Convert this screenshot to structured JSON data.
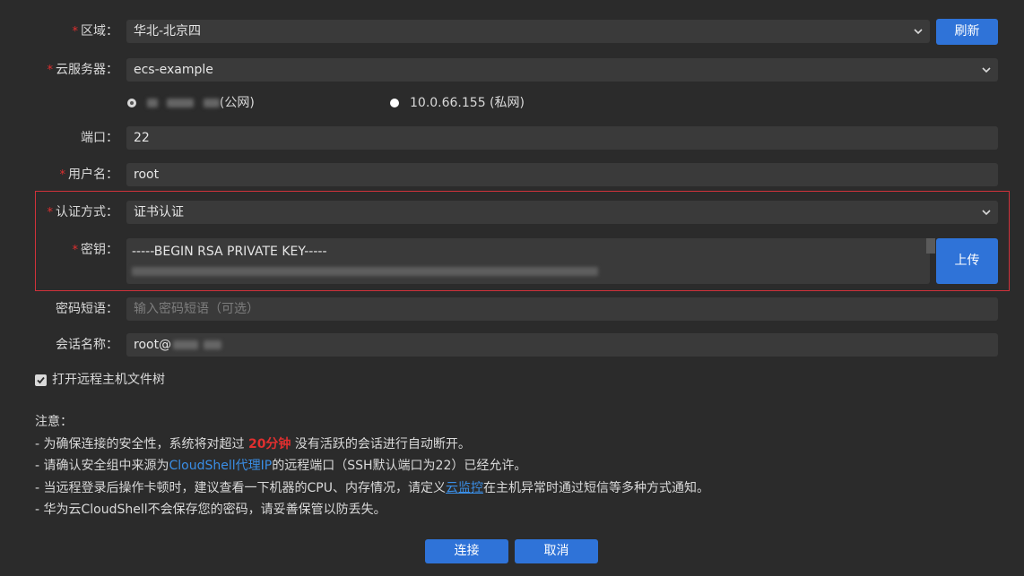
{
  "form": {
    "region": {
      "label": "区域：",
      "value": "华北-北京四",
      "refresh_label": "刷新"
    },
    "server": {
      "label": "云服务器：",
      "value": "ecs-example"
    },
    "ip_options": {
      "public_suffix": "(公网)",
      "private_value": "10.0.66.155 (私网)"
    },
    "port": {
      "label": "端口：",
      "value": "22"
    },
    "username": {
      "label": "用户名：",
      "value": "root"
    },
    "auth_method": {
      "label": "认证方式：",
      "value": "证书认证"
    },
    "key": {
      "label": "密钥：",
      "first_line": "-----BEGIN RSA PRIVATE KEY-----",
      "upload_label": "上传"
    },
    "passphrase": {
      "label": "密码短语：",
      "placeholder": "输入密码短语（可选）"
    },
    "session_name": {
      "label": "会话名称：",
      "value_prefix": "root@"
    },
    "open_tree": {
      "label": "打开远程主机文件树",
      "checked": true
    }
  },
  "notes": {
    "title": "注意：",
    "line1_a": "- 为确保连接的安全性，系统将对超过 ",
    "line1_hl": "20分钟",
    "line1_b": " 没有活跃的会话进行自动断开。",
    "line2_a": "- 请确认安全组中来源为",
    "line2_link": "CloudShell代理IP",
    "line2_b": "的远程端口（SSH默认端口为22）已经允许。",
    "line3_a": "- 当远程登录后操作卡顿时，建议查看一下机器的CPU、内存情况，请定义",
    "line3_link": "云监控",
    "line3_b": "在主机异常时通过短信等多种方式通知。",
    "line4": "- 华为云CloudShell不会保存您的密码，请妥善保管以防丢失。"
  },
  "actions": {
    "connect_label": "连接",
    "cancel_label": "取消"
  },
  "colors": {
    "accent": "#2f73d8",
    "required": "#e02f2f",
    "link": "#3a8ee6",
    "highlight_border": "#d0323a"
  }
}
